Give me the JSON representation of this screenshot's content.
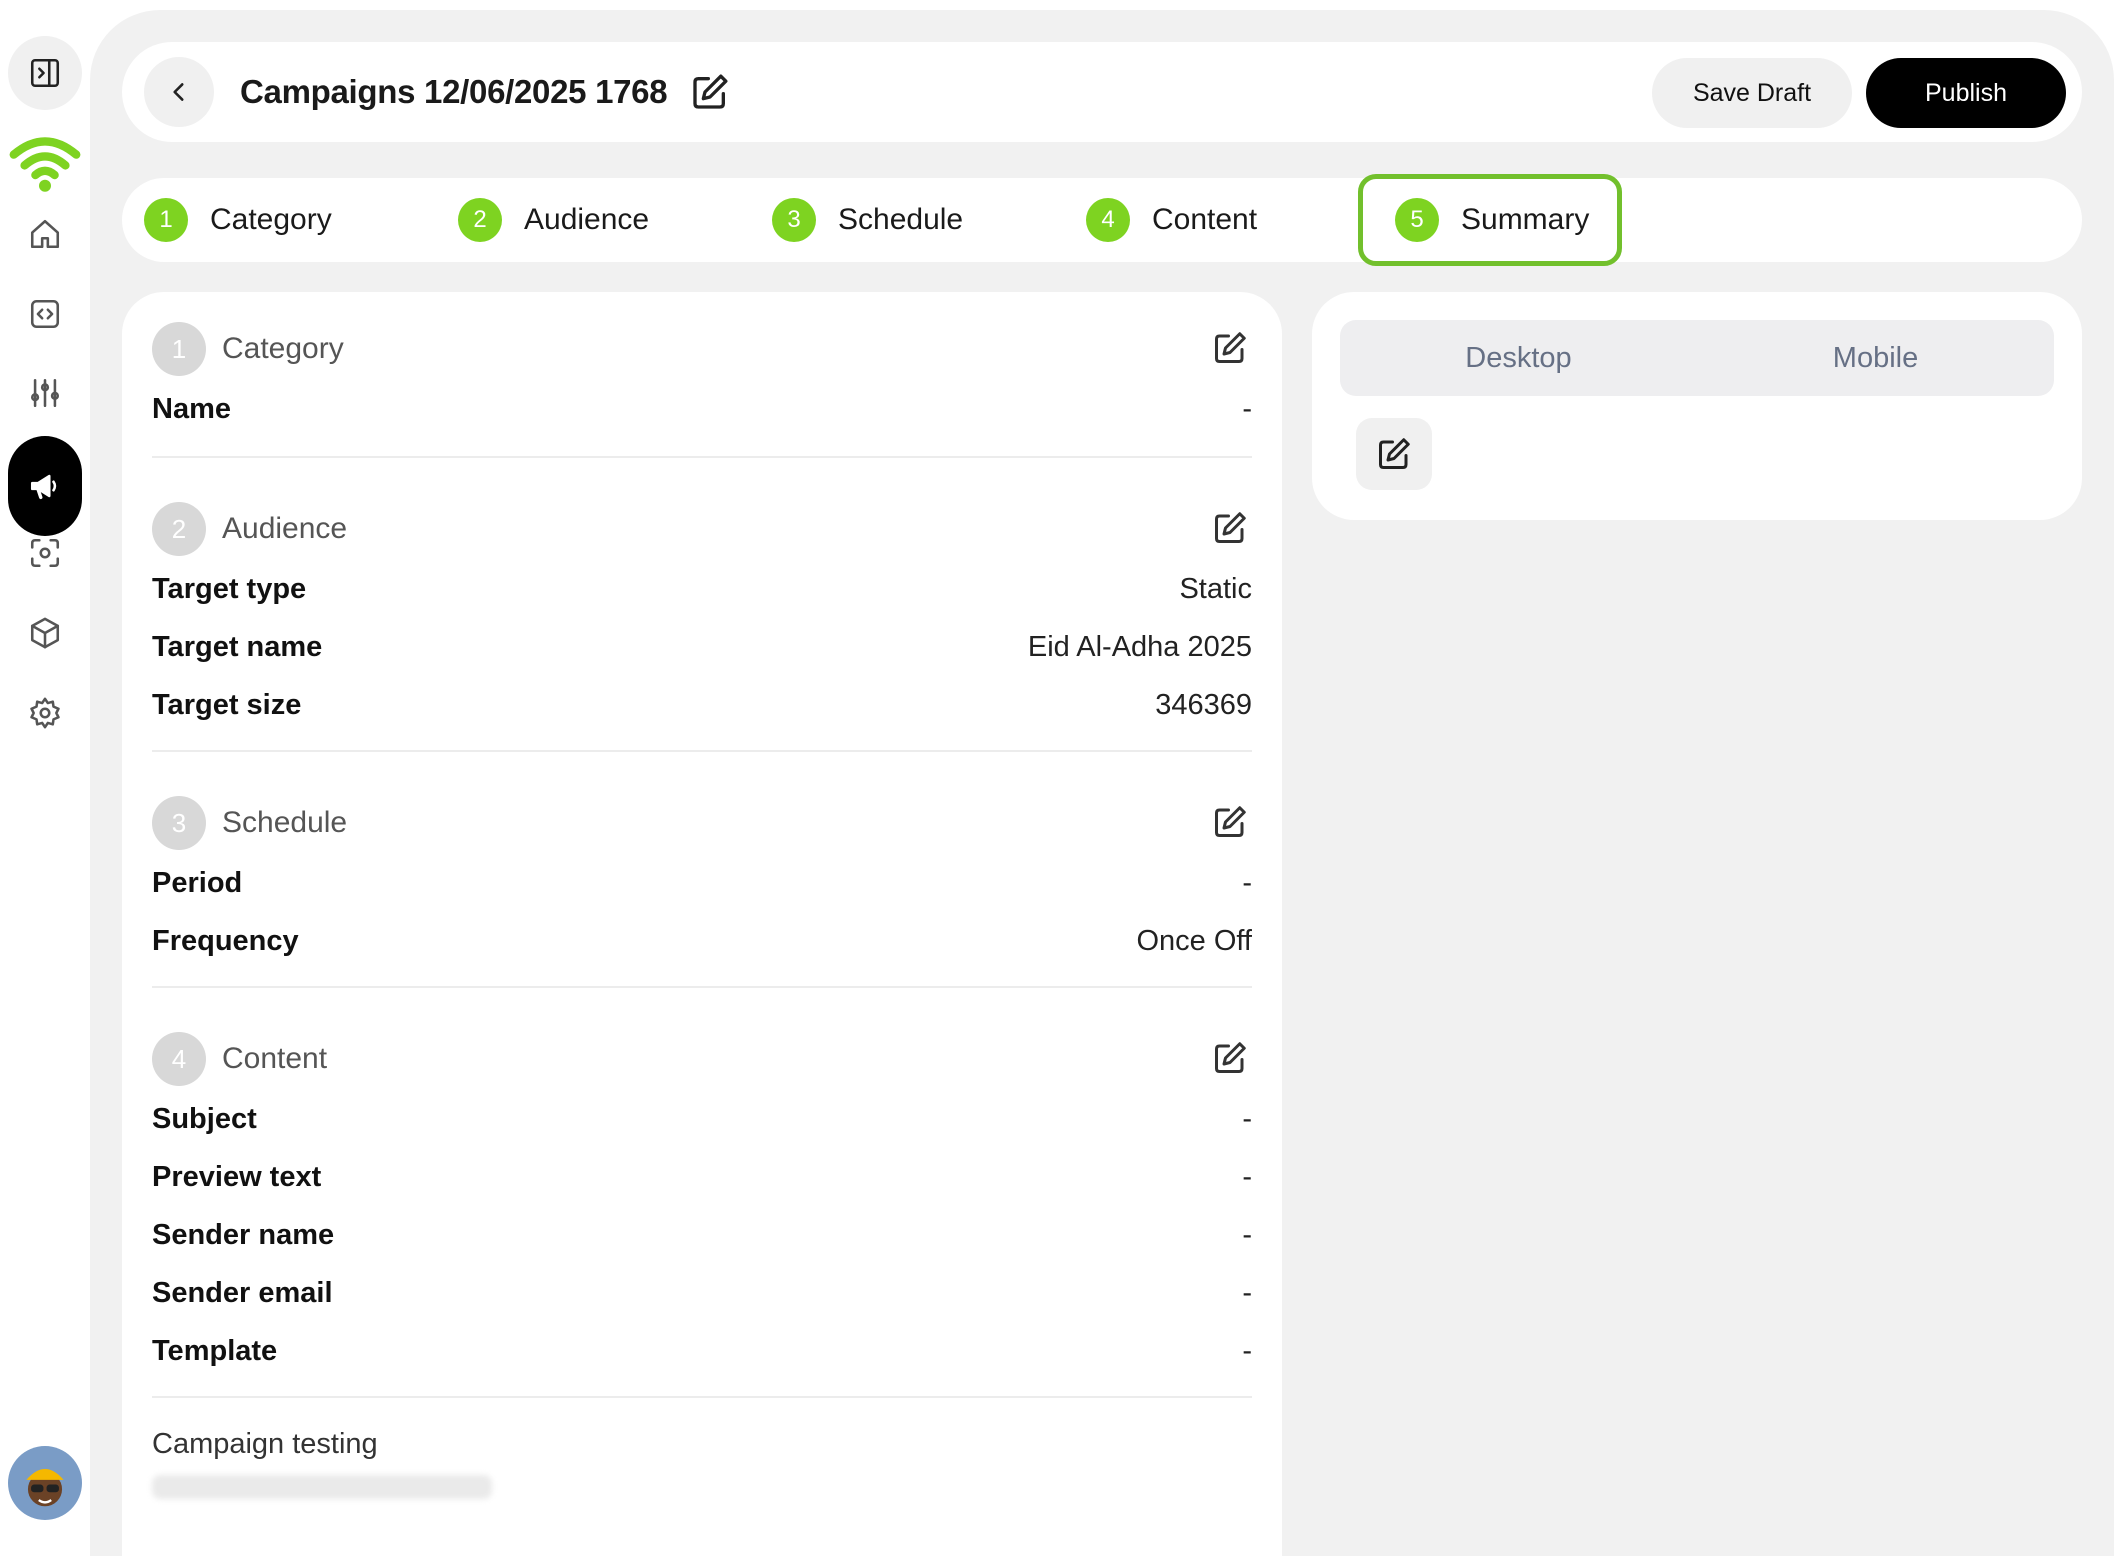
{
  "header": {
    "title": "Campaigns 12/06/2025 1768",
    "save_draft_label": "Save Draft",
    "publish_label": "Publish"
  },
  "stepper": {
    "steps": [
      {
        "num": "1",
        "label": "Category"
      },
      {
        "num": "2",
        "label": "Audience"
      },
      {
        "num": "3",
        "label": "Schedule"
      },
      {
        "num": "4",
        "label": "Content"
      },
      {
        "num": "5",
        "label": "Summary"
      }
    ],
    "active": "Summary"
  },
  "summary": {
    "category": {
      "num": "1",
      "title": "Category",
      "rows": [
        {
          "key": "Name",
          "value": "-"
        }
      ]
    },
    "audience": {
      "num": "2",
      "title": "Audience",
      "rows": [
        {
          "key": "Target type",
          "value": "Static"
        },
        {
          "key": "Target name",
          "value": "Eid Al-Adha 2025"
        },
        {
          "key": "Target size",
          "value": "346369"
        }
      ]
    },
    "schedule": {
      "num": "3",
      "title": "Schedule",
      "rows": [
        {
          "key": "Period",
          "value": "-"
        },
        {
          "key": "Frequency",
          "value": "Once Off"
        }
      ]
    },
    "content": {
      "num": "4",
      "title": "Content",
      "rows": [
        {
          "key": "Subject",
          "value": "-"
        },
        {
          "key": "Preview text",
          "value": "-"
        },
        {
          "key": "Sender name",
          "value": "-"
        },
        {
          "key": "Sender email",
          "value": "-"
        },
        {
          "key": "Template",
          "value": "-"
        }
      ]
    },
    "testing_title": "Campaign testing"
  },
  "preview": {
    "tabs": [
      "Desktop",
      "Mobile"
    ]
  },
  "colors": {
    "step_green": "#7ed321",
    "active_border": "#72c02c",
    "logo_green": "#7ed321",
    "canvas_bg": "#f1f1f1",
    "publish_bg": "#000000"
  },
  "icons": {
    "rail": [
      "sidebar-toggle-icon",
      "home-icon",
      "code-icon",
      "sliders-icon",
      "megaphone-icon",
      "scan-icon",
      "box-icon",
      "gear-icon"
    ],
    "logo": "wifi-logo-icon"
  }
}
